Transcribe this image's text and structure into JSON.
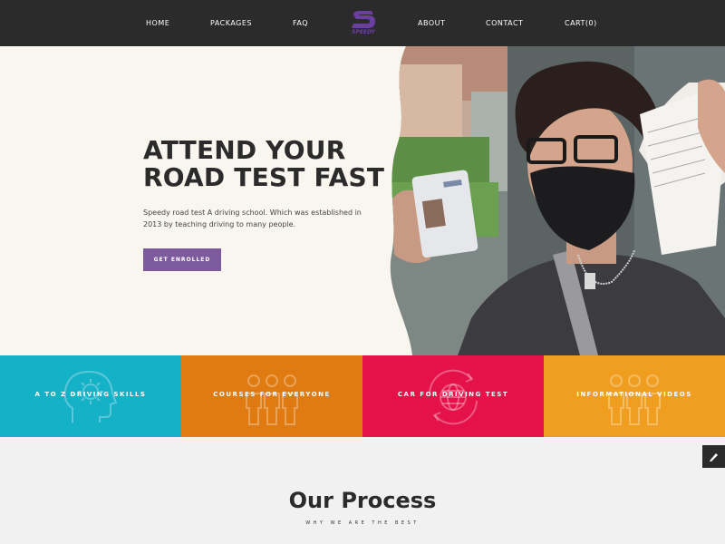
{
  "nav": {
    "items": [
      "HOME",
      "PACKAGES",
      "FAQ",
      "ABOUT",
      "CONTACT",
      "CART(0)"
    ],
    "logo_text": "SPEEDY"
  },
  "hero": {
    "title_line1": "ATTEND YOUR",
    "title_line2": "ROAD TEST FAST",
    "description": "Speedy road test A driving school. Which was established in 2013 by teaching driving to many people.",
    "cta_label": "GET ENROLLED"
  },
  "features": [
    {
      "label": "A TO Z DRIVING SKILLS",
      "color": "#14b1c7",
      "icon": "head-gear-icon"
    },
    {
      "label": "COURSES FOR EVERYONE",
      "color": "#e07b12",
      "icon": "people-group-icon"
    },
    {
      "label": "CAR FOR DRIVING TEST",
      "color": "#e5124a",
      "icon": "globe-refresh-icon"
    },
    {
      "label": "INFORMATIONAL VIDEOS",
      "color": "#f09e20",
      "icon": "people-group-icon"
    }
  ],
  "process": {
    "title": "Our Process",
    "subtitle": "WHY WE ARE THE BEST"
  },
  "colors": {
    "nav_bg": "#2b2b2b",
    "hero_bg": "#f9f6ef",
    "accent": "#7d5a9b",
    "logo": "#6b3fa0"
  }
}
